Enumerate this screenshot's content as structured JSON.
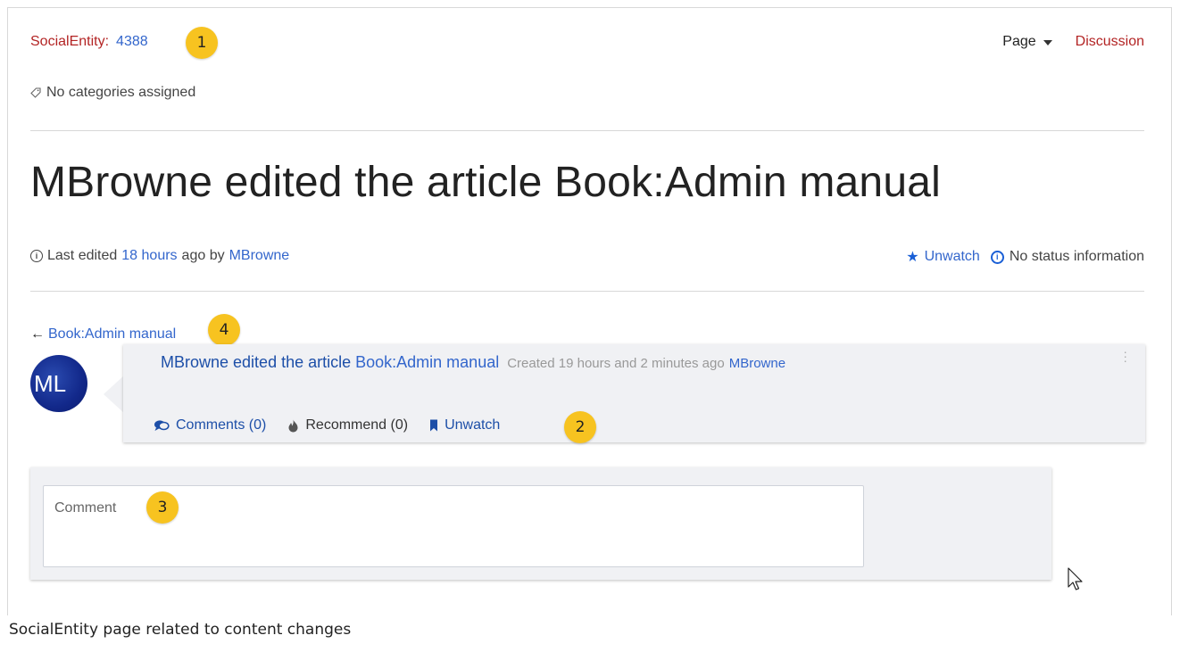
{
  "header": {
    "namespace_label": "SocialEntity:",
    "entity_id": "4388",
    "page_menu_label": "Page",
    "discussion_label": "Discussion"
  },
  "categories": {
    "text": "No categories assigned"
  },
  "page_title": "MBrowne edited the article Book:Admin manual",
  "meta": {
    "prefix": "Last edited",
    "time_link": "18 hours",
    "middle": "ago by",
    "author_link": "MBrowne",
    "unwatch_label": "Unwatch",
    "status_text": "No status information"
  },
  "backlink": {
    "arrow": "←",
    "label": "Book:Admin manual"
  },
  "avatar": {
    "initials": "ML"
  },
  "card": {
    "actor": "MBrowne",
    "verb": "edited the article",
    "article": "Book:Admin manual",
    "created": "Created 19 hours and 2 minutes ago",
    "created_by": "MBrowne",
    "actions": {
      "comments": "Comments (0)",
      "recommend": "Recommend (0)",
      "unwatch": "Unwatch"
    }
  },
  "comment": {
    "placeholder": "Comment"
  },
  "annotations": {
    "badge_1": "1",
    "badge_2": "2",
    "badge_3": "3",
    "badge_4": "4"
  },
  "caption": "SocialEntity page related to content changes",
  "colors": {
    "link": "#3366cc",
    "red_link": "#b32424",
    "badge": "#f7c320",
    "card_bg": "#f0f1f4"
  }
}
